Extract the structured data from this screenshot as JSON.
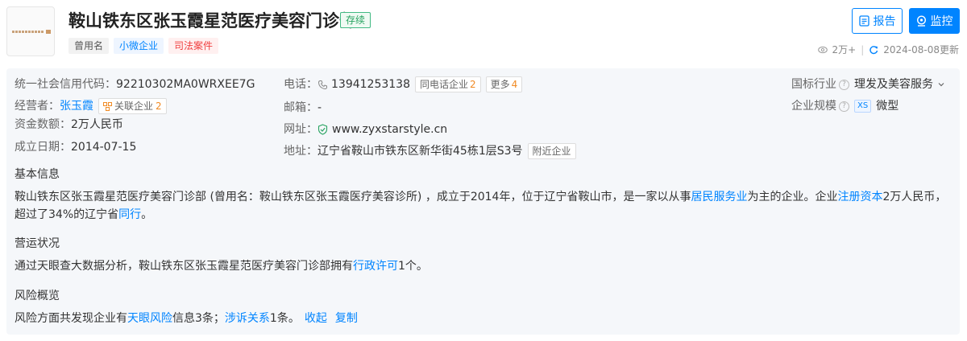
{
  "company": {
    "name": "鞍山铁东区张玉霞星范医疗美容门诊部",
    "status": "存续",
    "tags": [
      "曾用名",
      "小微企业",
      "司法案件"
    ]
  },
  "actions": {
    "report": "报告",
    "monitor": "监控"
  },
  "meta": {
    "views": "2万+",
    "updated": "2024-08-08更新"
  },
  "info": {
    "credit_code_label": "统一社会信用代码：",
    "credit_code": "92210302MA0WRXEE7G",
    "operator_label": "经营者：",
    "operator": "张玉霞",
    "related_label": "关联企业",
    "related_count": "2",
    "capital_label": "资金数额：",
    "capital": "2万人民币",
    "founded_label": "成立日期：",
    "founded": "2014-07-15",
    "phone_label": "电话：",
    "phone": "13941253138",
    "same_phone_label": "同电话企业",
    "same_phone_count": "2",
    "more_label": "更多",
    "more_count": "4",
    "email_label": "邮箱：",
    "email": "-",
    "website_label": "网址：",
    "website": "www.zyxstarstyle.cn",
    "address_label": "地址：",
    "address": "辽宁省鞍山市铁东区新华街45栋1层S3号",
    "nearby_label": "附近企业",
    "industry_label": "国标行业",
    "industry": "理发及美容服务",
    "scale_label": "企业规模",
    "scale_badge": "XS",
    "scale": "微型"
  },
  "basic": {
    "title": "基本信息",
    "p1": "鞍山铁东区张玉霞星范医疗美容门诊部 (曾用名：鞍山铁东区张玉霞医疗美容诊所) ，成立于2014年，位于辽宁省鞍山市，是一家以从事",
    "link1": "居民服务业",
    "p2": "为主的企业。企业",
    "link2": "注册资本",
    "p3": "2万人民币，超过了34%的辽宁省",
    "link3": "同行",
    "p4": "。"
  },
  "operation": {
    "title": "营运状况",
    "p1": "通过天眼查大数据分析，鞍山铁东区张玉霞星范医疗美容门诊部拥有",
    "link1": "行政许可",
    "p2": "1个。"
  },
  "risk": {
    "title": "风险概览",
    "p1": "风险方面共发现企业有",
    "link1": "天眼风险",
    "p2": "信息3条；",
    "link2": "涉诉关系",
    "p3": "1条。",
    "collapse": "收起",
    "copy": "复制"
  }
}
